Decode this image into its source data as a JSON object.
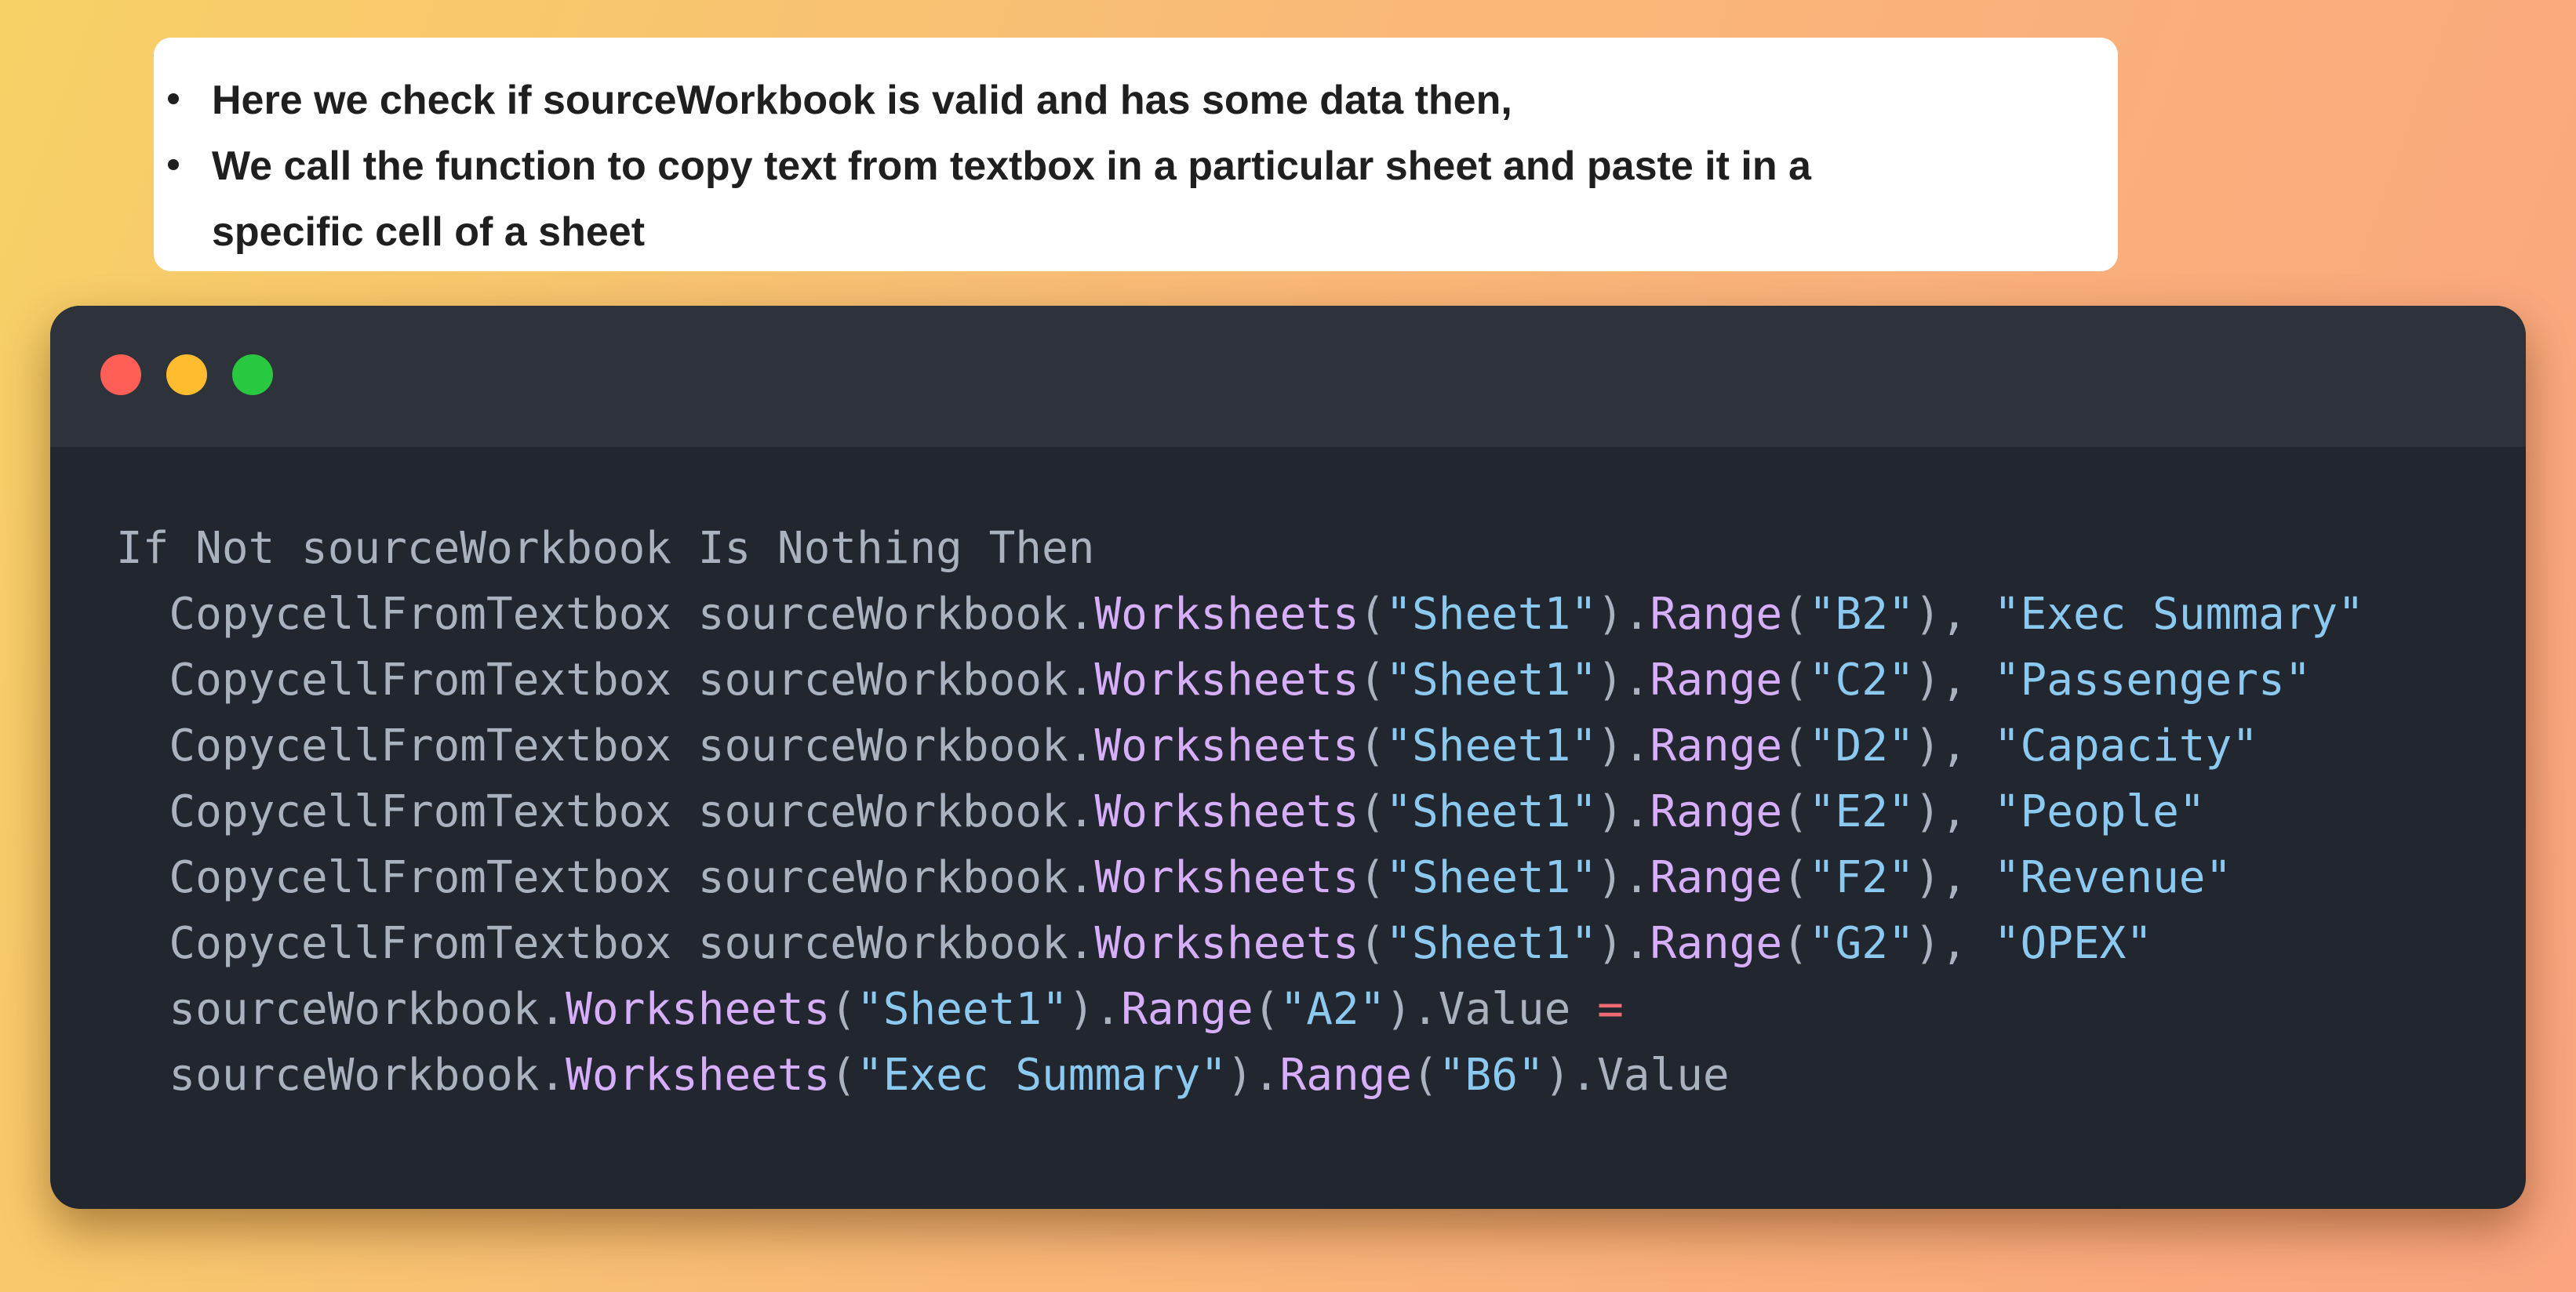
{
  "notes": {
    "items": [
      "Here we check if sourceWorkbook is valid and has some data then,",
      "We call the function to copy text from textbox in a particular sheet and paste it in a",
      "specific cell of a sheet"
    ]
  },
  "code_window": {
    "lines": [
      [
        {
          "text": "If Not sourceWorkbook Is Nothing Then",
          "kind": "default"
        }
      ],
      [
        {
          "text": "  CopycellFromTextbox sourceWorkbook.",
          "kind": "default"
        },
        {
          "text": "Worksheets",
          "kind": "prop"
        },
        {
          "text": "(",
          "kind": "default"
        },
        {
          "text": "\"Sheet1\"",
          "kind": "string"
        },
        {
          "text": ").",
          "kind": "default"
        },
        {
          "text": "Range",
          "kind": "prop"
        },
        {
          "text": "(",
          "kind": "default"
        },
        {
          "text": "\"B2\"",
          "kind": "string"
        },
        {
          "text": "), ",
          "kind": "default"
        },
        {
          "text": "\"Exec Summary\"",
          "kind": "string"
        }
      ],
      [
        {
          "text": "  CopycellFromTextbox sourceWorkbook.",
          "kind": "default"
        },
        {
          "text": "Worksheets",
          "kind": "prop"
        },
        {
          "text": "(",
          "kind": "default"
        },
        {
          "text": "\"Sheet1\"",
          "kind": "string"
        },
        {
          "text": ").",
          "kind": "default"
        },
        {
          "text": "Range",
          "kind": "prop"
        },
        {
          "text": "(",
          "kind": "default"
        },
        {
          "text": "\"C2\"",
          "kind": "string"
        },
        {
          "text": "), ",
          "kind": "default"
        },
        {
          "text": "\"Passengers\"",
          "kind": "string"
        }
      ],
      [
        {
          "text": "  CopycellFromTextbox sourceWorkbook.",
          "kind": "default"
        },
        {
          "text": "Worksheets",
          "kind": "prop"
        },
        {
          "text": "(",
          "kind": "default"
        },
        {
          "text": "\"Sheet1\"",
          "kind": "string"
        },
        {
          "text": ").",
          "kind": "default"
        },
        {
          "text": "Range",
          "kind": "prop"
        },
        {
          "text": "(",
          "kind": "default"
        },
        {
          "text": "\"D2\"",
          "kind": "string"
        },
        {
          "text": "), ",
          "kind": "default"
        },
        {
          "text": "\"Capacity\"",
          "kind": "string"
        }
      ],
      [
        {
          "text": "  CopycellFromTextbox sourceWorkbook.",
          "kind": "default"
        },
        {
          "text": "Worksheets",
          "kind": "prop"
        },
        {
          "text": "(",
          "kind": "default"
        },
        {
          "text": "\"Sheet1\"",
          "kind": "string"
        },
        {
          "text": ").",
          "kind": "default"
        },
        {
          "text": "Range",
          "kind": "prop"
        },
        {
          "text": "(",
          "kind": "default"
        },
        {
          "text": "\"E2\"",
          "kind": "string"
        },
        {
          "text": "), ",
          "kind": "default"
        },
        {
          "text": "\"People\"",
          "kind": "string"
        }
      ],
      [
        {
          "text": "  CopycellFromTextbox sourceWorkbook.",
          "kind": "default"
        },
        {
          "text": "Worksheets",
          "kind": "prop"
        },
        {
          "text": "(",
          "kind": "default"
        },
        {
          "text": "\"Sheet1\"",
          "kind": "string"
        },
        {
          "text": ").",
          "kind": "default"
        },
        {
          "text": "Range",
          "kind": "prop"
        },
        {
          "text": "(",
          "kind": "default"
        },
        {
          "text": "\"F2\"",
          "kind": "string"
        },
        {
          "text": "), ",
          "kind": "default"
        },
        {
          "text": "\"Revenue\"",
          "kind": "string"
        }
      ],
      [
        {
          "text": "  CopycellFromTextbox sourceWorkbook.",
          "kind": "default"
        },
        {
          "text": "Worksheets",
          "kind": "prop"
        },
        {
          "text": "(",
          "kind": "default"
        },
        {
          "text": "\"Sheet1\"",
          "kind": "string"
        },
        {
          "text": ").",
          "kind": "default"
        },
        {
          "text": "Range",
          "kind": "prop"
        },
        {
          "text": "(",
          "kind": "default"
        },
        {
          "text": "\"G2\"",
          "kind": "string"
        },
        {
          "text": "), ",
          "kind": "default"
        },
        {
          "text": "\"OPEX\"",
          "kind": "string"
        }
      ],
      [
        {
          "text": "  sourceWorkbook.",
          "kind": "default"
        },
        {
          "text": "Worksheets",
          "kind": "prop"
        },
        {
          "text": "(",
          "kind": "default"
        },
        {
          "text": "\"Sheet1\"",
          "kind": "string"
        },
        {
          "text": ").",
          "kind": "default"
        },
        {
          "text": "Range",
          "kind": "prop"
        },
        {
          "text": "(",
          "kind": "default"
        },
        {
          "text": "\"A2\"",
          "kind": "string"
        },
        {
          "text": ").Value ",
          "kind": "default"
        },
        {
          "text": "=",
          "kind": "op"
        }
      ],
      [
        {
          "text": "  sourceWorkbook.",
          "kind": "default"
        },
        {
          "text": "Worksheets",
          "kind": "prop"
        },
        {
          "text": "(",
          "kind": "default"
        },
        {
          "text": "\"Exec Summary\"",
          "kind": "string"
        },
        {
          "text": ").",
          "kind": "default"
        },
        {
          "text": "Range",
          "kind": "prop"
        },
        {
          "text": "(",
          "kind": "default"
        },
        {
          "text": "\"B6\"",
          "kind": "string"
        },
        {
          "text": ").Value",
          "kind": "default"
        }
      ]
    ]
  },
  "colors": {
    "window_bg": "#22262e",
    "titlebar_bg": "#2e323a",
    "close": "#ff5f57",
    "minimize": "#febc2e",
    "maximize": "#28c840",
    "token_default": "#abb2bf",
    "token_property": "#d7aefb",
    "token_string": "#8cc9f0",
    "token_operator": "#ef6b73"
  }
}
